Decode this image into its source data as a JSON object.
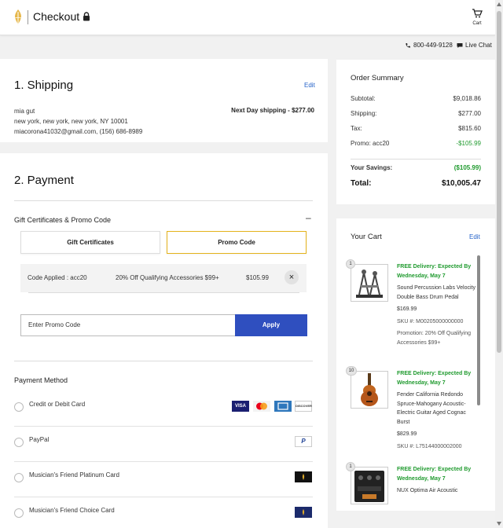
{
  "header": {
    "title": "Checkout",
    "cart_label": "Cart"
  },
  "support": {
    "phone": "800-449-9128",
    "chat": "Live Chat"
  },
  "shipping": {
    "heading": "1. Shipping",
    "edit": "Edit",
    "name": "mia gut",
    "address": "new york, new york, new york, NY 10001",
    "contact": "miacorona41032@gmail.com, (156) 686-8989",
    "method": "Next Day shipping - $277.00"
  },
  "payment": {
    "heading": "2. Payment",
    "gift_heading": "Gift Certificates & Promo Code",
    "collapse": "–",
    "tabs": [
      "Gift Certificates",
      "Promo Code"
    ],
    "applied": {
      "code": "Code Applied : acc20",
      "desc": "20% Off Qualifying Accessories $99+",
      "amount": "$105.99",
      "remove": "×"
    },
    "promo_placeholder": "Enter Promo Code",
    "apply_label": "Apply",
    "method_heading": "Payment Method",
    "methods": [
      "Credit or Debit Card",
      "PayPal",
      "Musician's Friend Platinum Card",
      "Musician's Friend Choice Card"
    ],
    "card_logos": [
      "VISA",
      "",
      "",
      "DISCOVER"
    ],
    "paypal_logo": "P"
  },
  "summary": {
    "heading": "Order Summary",
    "rows": [
      {
        "label": "Subtotal:",
        "value": "$9,018.86"
      },
      {
        "label": "Shipping:",
        "value": "$277.00"
      },
      {
        "label": "Tax:",
        "value": "$815.60"
      },
      {
        "label": "Promo: acc20",
        "value": "-$105.99"
      }
    ],
    "savings_label": "Your Savings:",
    "savings_value": "($105.99)",
    "total_label": "Total:",
    "total_value": "$10,005.47",
    "colors": {
      "green": "#1f9a2e"
    }
  },
  "cart": {
    "heading": "Your Cart",
    "edit": "Edit",
    "items": [
      {
        "qty": "1",
        "delivery": "FREE Delivery: Expected By Wednesday, May 7",
        "name": "Sound Percussion Labs Velocity Double Bass Drum Pedal",
        "price": "$169.99",
        "sku": "SKU #: M00205000000000",
        "promo": "Promotion: 20% Off Qualifying Accessories $99+"
      },
      {
        "qty": "10",
        "delivery": "FREE Delivery: Expected By Wednesday, May 7",
        "name": "Fender California Redondo Spruce-Mahogany Acoustic-Electric Guitar Aged Cognac Burst",
        "price": "$829.99",
        "sku": "SKU #: L75144000002000"
      },
      {
        "qty": "1",
        "delivery": "FREE Delivery: Expected By Wednesday, May 7",
        "name": "NUX Optima Air Acoustic"
      }
    ]
  }
}
